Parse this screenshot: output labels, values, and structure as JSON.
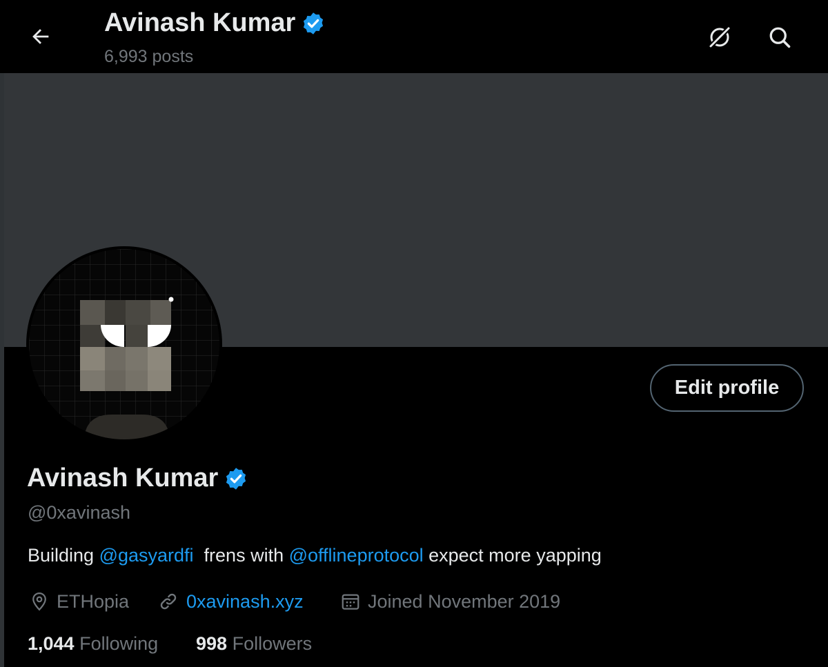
{
  "header": {
    "title": "Avinash Kumar",
    "posts_count": "6,993 posts",
    "back_icon": "arrow-left-icon",
    "grok_icon": "grok-icon",
    "search_icon": "search-icon"
  },
  "profile": {
    "display_name": "Avinash Kumar",
    "handle": "@0xavinash",
    "verified_color": "#1d9bf0",
    "edit_button_label": "Edit profile",
    "bio": {
      "part1": "Building ",
      "mention1": "@gasyardfi",
      "part2": "  frens with ",
      "mention2": "@offlineprotocol",
      "part3": " expect more yapping"
    },
    "location": "ETHopia",
    "website": "0xavinash.xyz",
    "joined": "Joined November 2019",
    "following_count": "1,044",
    "following_label": "Following",
    "followers_count": "998",
    "followers_label": "Followers"
  },
  "colors": {
    "background": "#000000",
    "banner": "#333639",
    "link": "#1d9bf0",
    "secondary_text": "#71767b"
  }
}
